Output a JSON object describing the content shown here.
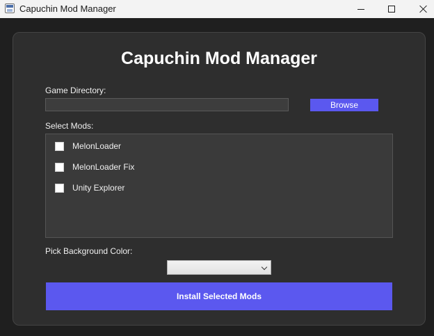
{
  "window": {
    "title": "Capuchin Mod Manager",
    "icon": "app-window-icon"
  },
  "main": {
    "heading": "Capuchin Mod Manager",
    "game_directory": {
      "label": "Game Directory:",
      "value": "",
      "browse_label": "Browse"
    },
    "mods": {
      "label": "Select Mods:",
      "items": [
        {
          "label": "MelonLoader",
          "checked": false
        },
        {
          "label": "MelonLoader Fix",
          "checked": false
        },
        {
          "label": "Unity Explorer",
          "checked": false
        }
      ]
    },
    "background_color": {
      "label": "Pick Background Color:",
      "selected": ""
    },
    "install_label": "Install Selected Mods"
  },
  "colors": {
    "accent": "#5b58ef",
    "panel": "#2e2e2e",
    "background": "#1f1f1f"
  }
}
